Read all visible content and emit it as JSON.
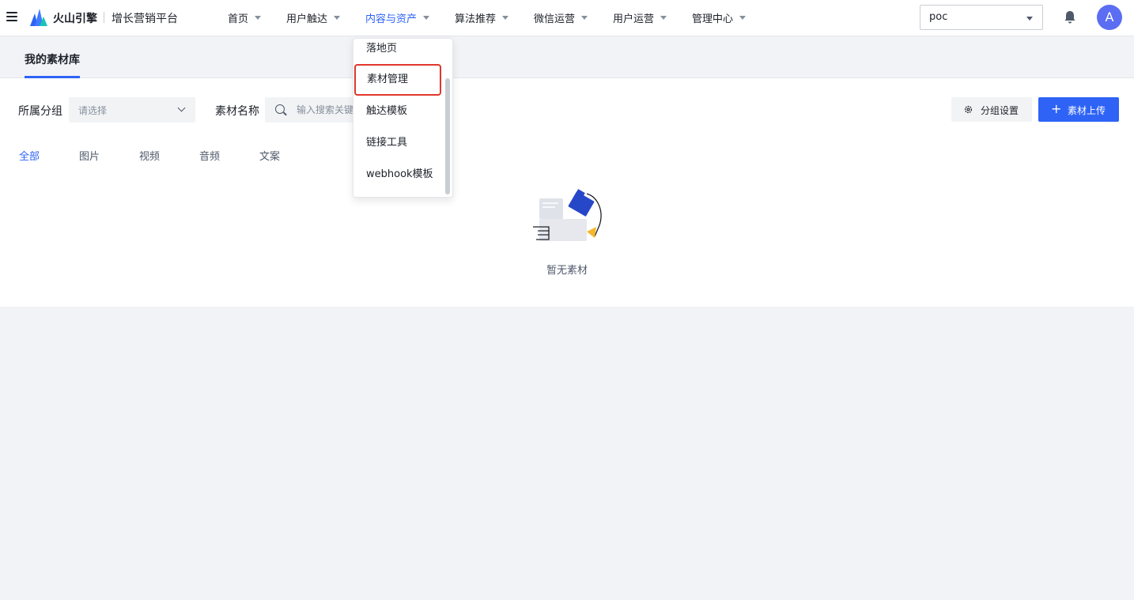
{
  "header": {
    "brand": "火山引擎",
    "product": "增长营销平台",
    "nav": [
      {
        "label": "首页"
      },
      {
        "label": "用户触达"
      },
      {
        "label": "内容与资产"
      },
      {
        "label": "算法推荐"
      },
      {
        "label": "微信运营"
      },
      {
        "label": "用户运营"
      },
      {
        "label": "管理中心"
      }
    ],
    "project": "poc",
    "avatar": "A"
  },
  "subhead": {
    "tab": "我的素材库"
  },
  "filters": {
    "group_label": "所属分组",
    "group_placeholder": "请选择",
    "name_label": "素材名称",
    "search_placeholder": "输入搜索关键",
    "group_settings": "分组设置",
    "upload": "素材上传",
    "upload_plus": "+",
    "types": [
      "全部",
      "图片",
      "视频",
      "音频",
      "文案"
    ]
  },
  "empty": {
    "text": "暂无素材"
  },
  "dropdown": {
    "items": [
      "落地页",
      "素材管理",
      "触达模板",
      "链接工具",
      "webhook模板"
    ]
  },
  "colors": {
    "accent": "#2e63f6",
    "highlight": "#e0372b"
  }
}
